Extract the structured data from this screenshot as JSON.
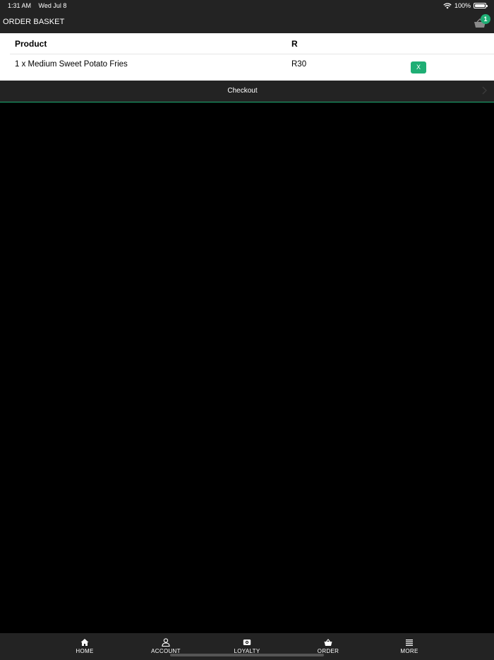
{
  "status_bar": {
    "time": "1:31 AM",
    "date": "Wed Jul 8",
    "battery": "100%"
  },
  "header": {
    "title": "ORDER BASKET",
    "basket_count": "1",
    "basket_icon": "basket-icon"
  },
  "basket": {
    "columns": {
      "product": "Product",
      "price": "R"
    },
    "items": [
      {
        "name": "1 x Medium Sweet Potato Fries",
        "price": "R30",
        "remove_label": "X"
      }
    ]
  },
  "checkout": {
    "label": "Checkout",
    "icon": "chevron-right-icon"
  },
  "tabs": [
    {
      "label": "HOME",
      "icon": "home-icon"
    },
    {
      "label": "ACCOUNT",
      "icon": "user-icon"
    },
    {
      "label": "LOYALTY",
      "icon": "loyalty-icon"
    },
    {
      "label": "ORDER",
      "icon": "basket-icon"
    },
    {
      "label": "MORE",
      "icon": "menu-icon"
    }
  ],
  "colors": {
    "accent": "#1fae74",
    "bar": "#232323",
    "background": "#000000",
    "panel": "#ffffff"
  }
}
